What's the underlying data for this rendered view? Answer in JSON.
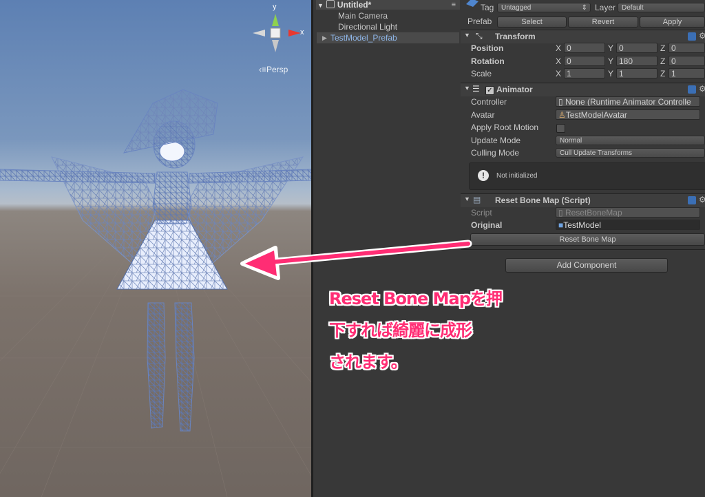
{
  "scene_view": {
    "gizmo_x_label": "x",
    "gizmo_y_label": "y",
    "projection_label": "Persp"
  },
  "hierarchy": {
    "scene_name": "Untitled*",
    "menu_glyph": "≡",
    "items": [
      {
        "label": "Main Camera"
      },
      {
        "label": "Directional Light"
      },
      {
        "label": "TestModel_Prefab"
      }
    ]
  },
  "inspector": {
    "tag_label": "Tag",
    "tag_value": "Untagged",
    "layer_label": "Layer",
    "layer_value": "Default",
    "prefab_label": "Prefab",
    "prefab_buttons": [
      "Select",
      "Revert",
      "Apply"
    ],
    "transform": {
      "title": "Transform",
      "position_label": "Position",
      "rotation_label": "Rotation",
      "scale_label": "Scale",
      "axis_x": "X",
      "axis_y": "Y",
      "axis_z": "Z",
      "position": [
        "0",
        "0",
        "0"
      ],
      "rotation": [
        "0",
        "180",
        "0"
      ],
      "scale": [
        "1",
        "1",
        "1"
      ]
    },
    "animator": {
      "title": "Animator",
      "controller_label": "Controller",
      "controller_value": "None (Runtime Animator Controlle",
      "avatar_label": "Avatar",
      "avatar_value": "TestModelAvatar",
      "apply_root_motion_label": "Apply Root Motion",
      "update_mode_label": "Update Mode",
      "update_mode_value": "Normal",
      "culling_mode_label": "Culling Mode",
      "culling_mode_value": "Cull Update Transforms",
      "status": "Not initialized"
    },
    "reset_bone_map": {
      "title": "Reset Bone Map (Script)",
      "script_label": "Script",
      "script_value": "ResetBoneMap",
      "original_label": "Original",
      "original_value": "TestModel",
      "button_label": "Reset Bone Map"
    },
    "add_component_label": "Add Component"
  },
  "annotation": {
    "lines": [
      "Reset Bone Mapを押",
      "下すれば綺麗に成形",
      "されます。"
    ],
    "color": "#ff2d74"
  }
}
